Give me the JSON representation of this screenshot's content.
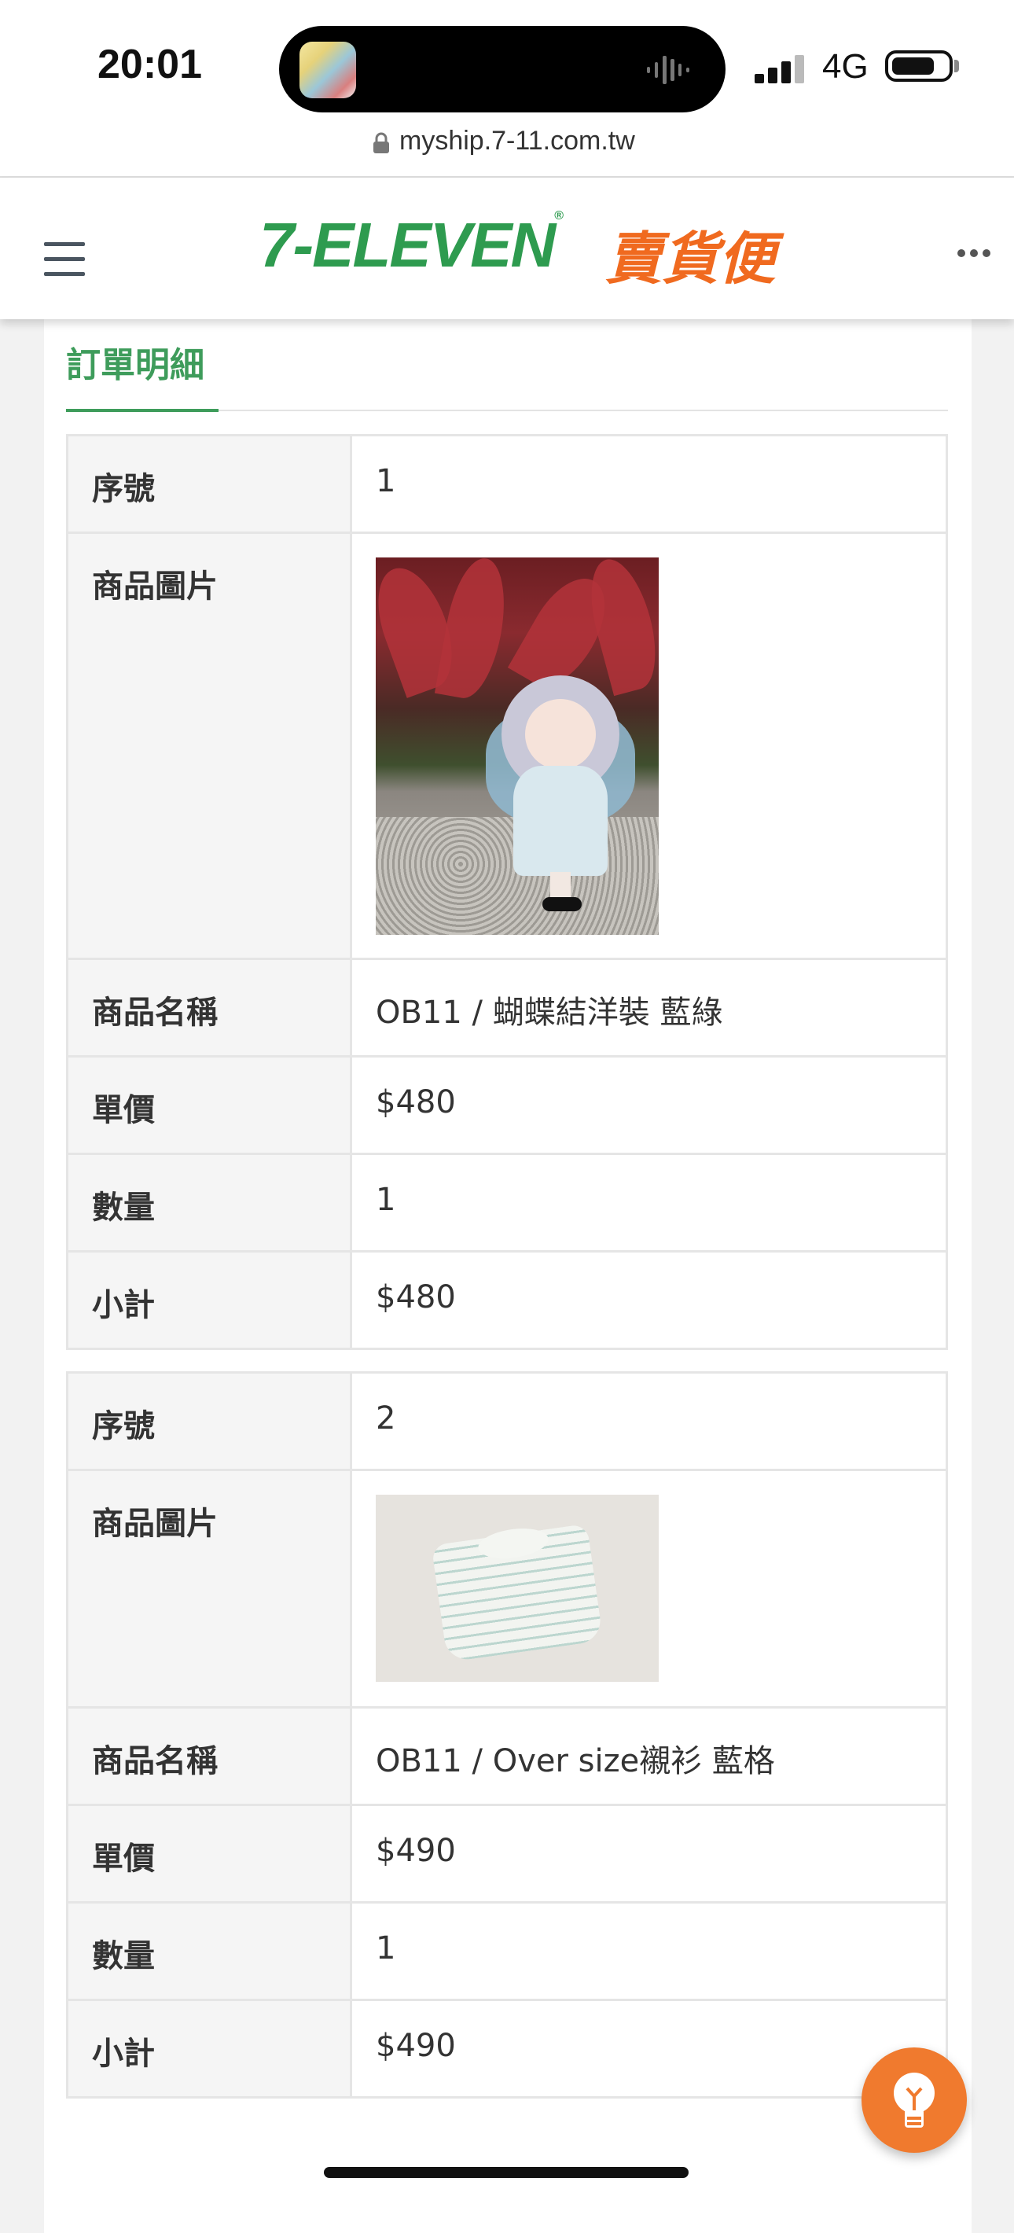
{
  "status_bar": {
    "time": "20:01",
    "network": "4G",
    "battery_level": 0.78
  },
  "browser": {
    "url": "myship.7-11.com.tw"
  },
  "header": {
    "brand_logo": "7-ELEVEN",
    "brand_service": "賣貨便",
    "menu_icon": "hamburger-icon",
    "more_icon": "more-icon"
  },
  "section": {
    "title": "訂單明細"
  },
  "labels": {
    "seq": "序號",
    "image": "商品圖片",
    "name": "商品名稱",
    "unit_price": "單價",
    "quantity": "數量",
    "subtotal": "小計"
  },
  "items": [
    {
      "seq": "1",
      "name": "OB11 / 蝴蝶結洋裝 藍綠",
      "unit_price": "$480",
      "quantity": "1",
      "subtotal": "$480"
    },
    {
      "seq": "2",
      "name": "OB11 / Over size襯衫 藍格",
      "unit_price": "$490",
      "quantity": "1",
      "subtotal": "$490"
    }
  ],
  "fab": {
    "icon": "lightbulb-icon",
    "color": "#f07a2e"
  }
}
